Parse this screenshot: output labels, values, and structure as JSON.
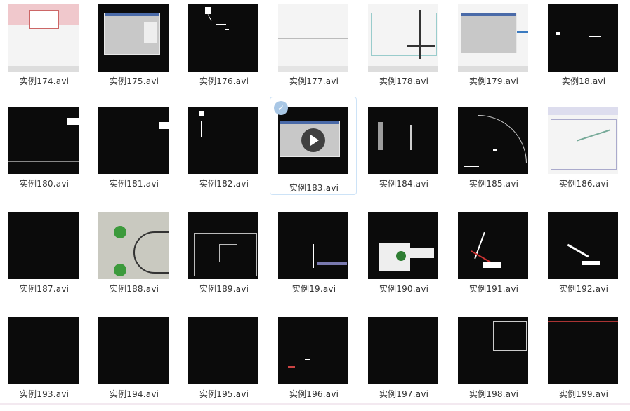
{
  "files": [
    {
      "name": "实例174.avi"
    },
    {
      "name": "实例175.avi"
    },
    {
      "name": "实例176.avi"
    },
    {
      "name": "实例177.avi"
    },
    {
      "name": "实例178.avi"
    },
    {
      "name": "实例179.avi"
    },
    {
      "name": "实例18.avi"
    },
    {
      "name": "实例180.avi"
    },
    {
      "name": "实例181.avi"
    },
    {
      "name": "实例182.avi"
    },
    {
      "name": "实例183.avi",
      "selected": true
    },
    {
      "name": "实例184.avi"
    },
    {
      "name": "实例185.avi"
    },
    {
      "name": "实例186.avi"
    },
    {
      "name": "实例187.avi"
    },
    {
      "name": "实例188.avi"
    },
    {
      "name": "实例189.avi"
    },
    {
      "name": "实例19.avi"
    },
    {
      "name": "实例190.avi"
    },
    {
      "name": "实例191.avi"
    },
    {
      "name": "实例192.avi"
    },
    {
      "name": "实例193.avi"
    },
    {
      "name": "实例194.avi"
    },
    {
      "name": "实例195.avi"
    },
    {
      "name": "实例196.avi"
    },
    {
      "name": "实例197.avi"
    },
    {
      "name": "实例198.avi"
    },
    {
      "name": "实例199.avi"
    }
  ],
  "icons": {
    "selected_check": "check-icon",
    "play": "play-icon"
  },
  "colors": {
    "selection_border": "#cde3f7",
    "check_bg": "#a9c7e5",
    "thumb_bg": "#0b0b0b"
  }
}
